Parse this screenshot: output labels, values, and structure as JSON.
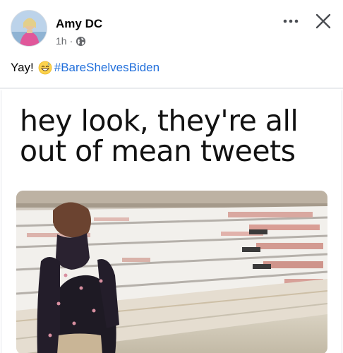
{
  "post": {
    "author_name": "Amy DC",
    "time": "1h",
    "separator": "·",
    "text_prefix": "Yay!",
    "hashtag": "#BareShelvesBiden"
  },
  "icons": {
    "more": "more-options-icon",
    "close": "close-icon",
    "privacy": "globe-icon",
    "emoji": "grinning-sweat-emoji-icon"
  },
  "meme": {
    "caption_line1": "hey look, they're all",
    "caption_line2": "out of mean tweets"
  },
  "colors": {
    "hashtag": "#216fdb",
    "meta_text": "#65676b",
    "divider": "#e9ebee"
  }
}
